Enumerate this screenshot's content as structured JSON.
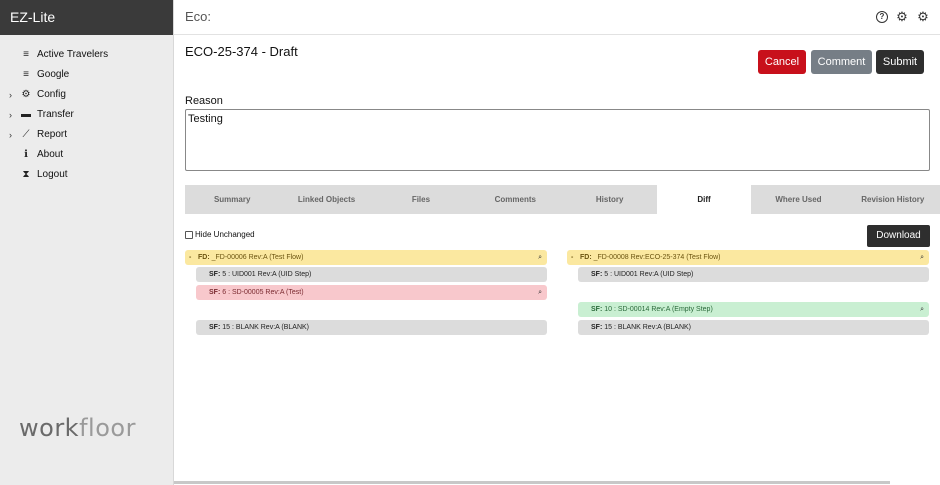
{
  "sidebar": {
    "brand": "EZ-Lite",
    "items": [
      {
        "label": "Active Travelers",
        "icon": "list-icon",
        "glyph": "≡",
        "chevron": ""
      },
      {
        "label": "Google",
        "icon": "list-icon",
        "glyph": "≡",
        "chevron": ""
      },
      {
        "label": "Config",
        "icon": "gear-icon",
        "glyph": "⚙",
        "chevron": "›"
      },
      {
        "label": "Transfer",
        "icon": "folder-icon",
        "glyph": "▬",
        "chevron": "›"
      },
      {
        "label": "Report",
        "icon": "chart-icon",
        "glyph": "⟋",
        "chevron": "›"
      },
      {
        "label": "About",
        "icon": "info-icon",
        "glyph": "ℹ",
        "chevron": ""
      },
      {
        "label": "Logout",
        "icon": "hourglass-icon",
        "glyph": "⧗",
        "chevron": ""
      }
    ],
    "logo_part1": "work",
    "logo_part2": "floor"
  },
  "topbar": {
    "title": "Eco:",
    "help_glyph": "?",
    "gear_glyph": "⚙",
    "settings_glyph": "⚙"
  },
  "main": {
    "title": "ECO-25-374 - Draft",
    "buttons": {
      "cancel": "Cancel",
      "comment": "Comment",
      "submit": "Submit"
    },
    "reason_label": "Reason",
    "reason_value": "Testing",
    "tabs": [
      "Summary",
      "Linked Objects",
      "Files",
      "Comments",
      "History",
      "Diff",
      "Where Used",
      "Revision History"
    ],
    "active_tab": "Diff",
    "hide_unchanged_label": "Hide Unchanged",
    "download_label": "Download"
  },
  "diff": {
    "left": {
      "fd": {
        "tag": "FD:",
        "text": "_FD-00006 Rev:A (Test Flow)"
      },
      "rows": [
        {
          "tag": "SF:",
          "text": "5 : UID001 Rev:A (UID Step)"
        },
        {
          "tag": "SF:",
          "text": "6 : SD-00005 Rev:A (Test)"
        },
        {
          "tag": "SF:",
          "text": "15 : BLANK Rev:A (BLANK)"
        }
      ]
    },
    "right": {
      "fd": {
        "tag": "FD:",
        "text": "_FD-00008 Rev:ECO-25-374 (Test Flow)"
      },
      "rows": [
        {
          "tag": "SF:",
          "text": "5 : UID001 Rev:A (UID Step)"
        },
        {
          "tag": "SF:",
          "text": "10 : SD-00014 Rev:A (Empty Step)"
        },
        {
          "tag": "SF:",
          "text": "15 : BLANK Rev:A (BLANK)"
        }
      ]
    },
    "minus_glyph": "-",
    "search_glyph": "⌕"
  },
  "colors": {
    "brand_bg": "#3a3a3a",
    "cancel": "#c8101b",
    "comment": "#767e86",
    "submit": "#2e2e2e",
    "changed": "#fbe8a0",
    "removed": "#f8c8cc",
    "added": "#c9efd2",
    "unchanged": "#dcdcdc"
  }
}
